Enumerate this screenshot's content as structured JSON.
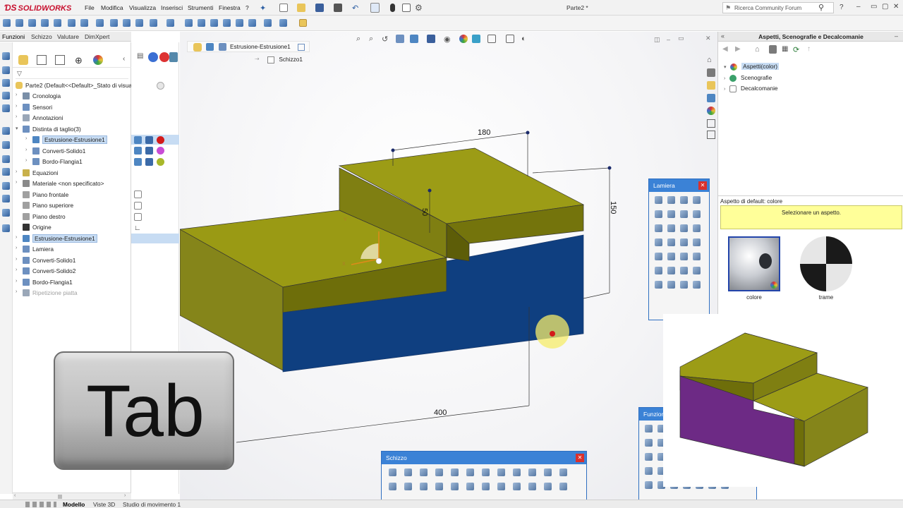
{
  "app": {
    "logo": "SOLIDWORKS",
    "document_title": "Parte2 *",
    "menu": [
      "File",
      "Modifica",
      "Visualizza",
      "Inserisci",
      "Strumenti",
      "Finestra",
      "?"
    ],
    "search_placeholder": "Ricerca Community Forum"
  },
  "feature_tabs": [
    "Funzioni",
    "Schizzo",
    "Valutare",
    "DimXpert"
  ],
  "tree": {
    "root": "Parte2  (Default<<Default>_Stato di visuali",
    "items": [
      {
        "label": "Cronologia",
        "level": 1
      },
      {
        "label": "Sensori",
        "level": 1
      },
      {
        "label": "Annotazioni",
        "level": 1
      },
      {
        "label": "Distinta di taglio(3)",
        "level": 1
      },
      {
        "label": "Estrusione-Estrusione1",
        "level": 2,
        "selected": true
      },
      {
        "label": "Converti-Solido1",
        "level": 2
      },
      {
        "label": "Bordo-Flangia1",
        "level": 2
      },
      {
        "label": "Equazioni",
        "level": 1
      },
      {
        "label": "Materiale <non specificato>",
        "level": 1
      },
      {
        "label": "Piano frontale",
        "level": 1
      },
      {
        "label": "Piano superiore",
        "level": 1
      },
      {
        "label": "Piano destro",
        "level": 1
      },
      {
        "label": "Origine",
        "level": 1
      },
      {
        "label": "Estrusione-Estrusione1",
        "level": 1,
        "selected": true
      },
      {
        "label": "Lamiera",
        "level": 1
      },
      {
        "label": "Converti-Solido1",
        "level": 1
      },
      {
        "label": "Converti-Solido2",
        "level": 1
      },
      {
        "label": "Bordo-Flangia1",
        "level": 1
      },
      {
        "label": "Ripetizione piatta",
        "level": 1,
        "dim": true
      }
    ]
  },
  "breadcrumb": {
    "feature": "Estrusione-Estrusione1",
    "sketch": "Schizzo1"
  },
  "dimensions": {
    "top": "180",
    "mid": "50",
    "right": "150",
    "bottom": "400"
  },
  "taskpane": {
    "title": "Aspetti, Scenografie e Decalcomanie",
    "items": [
      "Aspetti(color)",
      "Scenografie",
      "Decalcomanie"
    ],
    "default_label": "Aspetto di default: colore",
    "hint": "Selezionare un aspetto.",
    "swatches": [
      "colore",
      "trame"
    ]
  },
  "panels": {
    "lamiera": "Lamiera",
    "schizzo": "Schizzo",
    "funzioni": "Funzion"
  },
  "overlay_key": "Tab",
  "bottom_tabs": [
    "Modello",
    "Viste 3D",
    "Studio di movimento 1"
  ],
  "colors": {
    "olive": "#9a9a12",
    "olive_dark": "#6e6e0a",
    "blue_face": "#0f3f80",
    "purple_face": "#6d2a85",
    "accent_blue": "#3b82d6"
  }
}
